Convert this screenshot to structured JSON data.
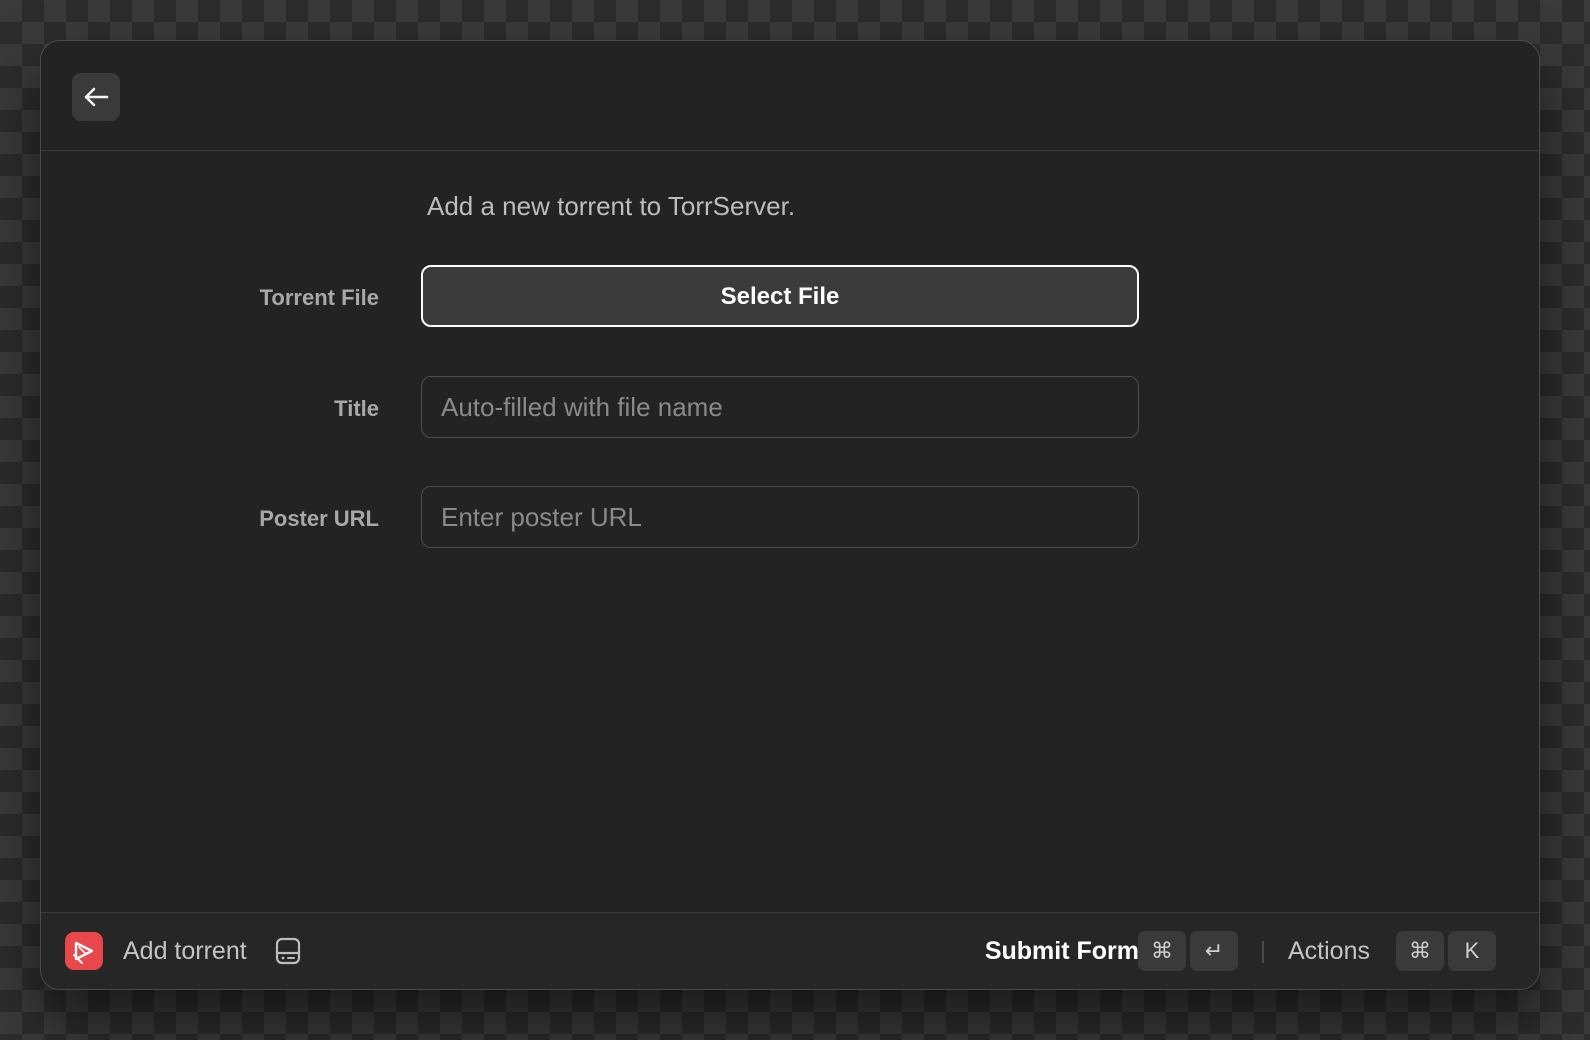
{
  "header": {
    "back_icon": "arrow-left-icon"
  },
  "form": {
    "description": "Add a new torrent to TorrServer.",
    "fields": [
      {
        "label": "Torrent File",
        "button_label": "Select File"
      },
      {
        "label": "Title",
        "value": "",
        "placeholder": "Auto-filled with file name"
      },
      {
        "label": "Poster URL",
        "value": "",
        "placeholder": "Enter poster URL"
      }
    ]
  },
  "footer": {
    "app_icon": "torrserver-app-icon",
    "command_name": "Add torrent",
    "command_icon": "hard-drive-icon",
    "primary_action": "Submit Form",
    "primary_shortcut": [
      "⌘",
      "↵"
    ],
    "actions_label": "Actions",
    "actions_shortcut": [
      "⌘",
      "K"
    ]
  },
  "colors": {
    "window_bg": "#232323",
    "accent_app_icon": "#e8474c",
    "focus_border": "#ffffff"
  }
}
